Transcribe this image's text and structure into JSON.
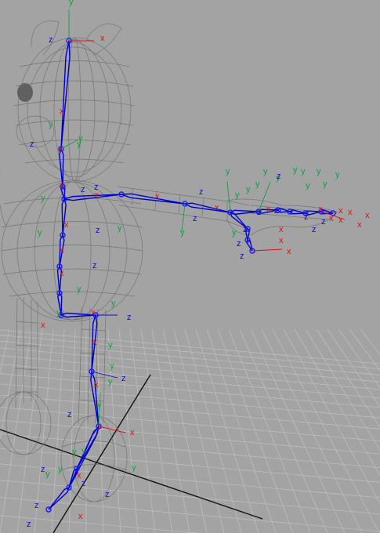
{
  "viewport": {
    "background": "#a3a3a3",
    "grid_color": "#bdbdbd",
    "grid_axis_color": "#111111",
    "mesh_color": "#6e6e6e",
    "joint_color": "#1a1aff",
    "bone_color": "#0000cc"
  },
  "axis_colors": {
    "x": "#e01010",
    "y": "#10a040",
    "z": "#1010d0"
  },
  "axis_labels": {
    "x": "x",
    "y": "y",
    "z": "z"
  }
}
